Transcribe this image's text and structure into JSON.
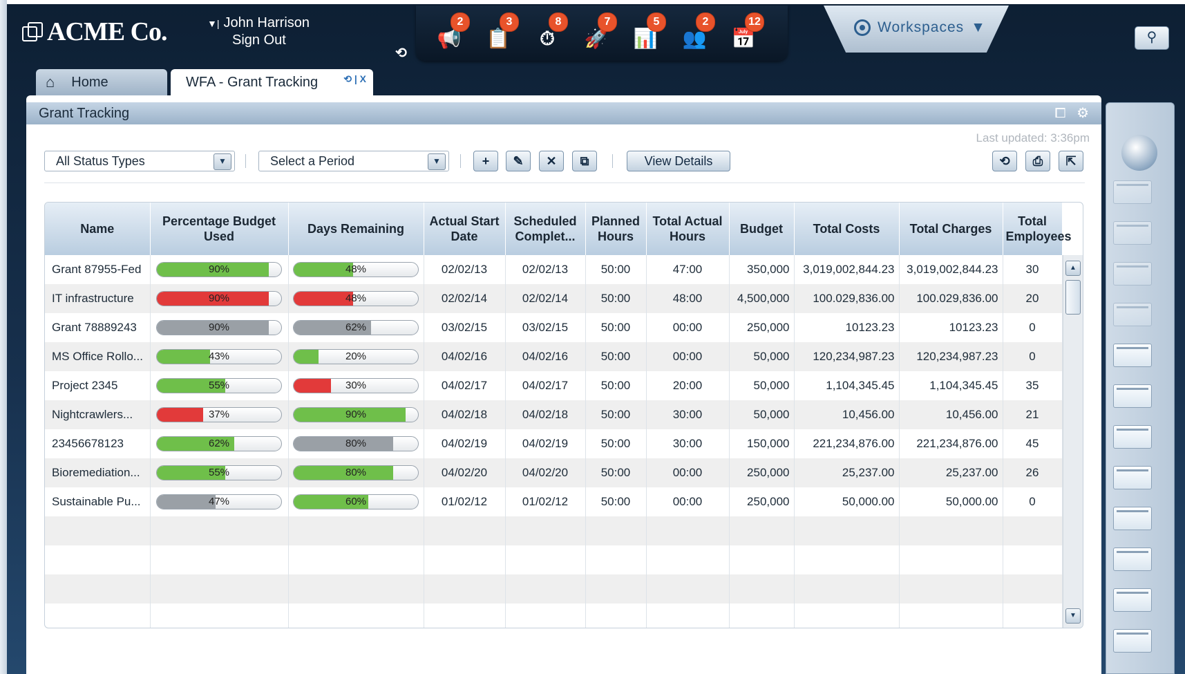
{
  "app": {
    "logo_text": "ACME Co."
  },
  "user": {
    "name": "John Harrison",
    "sign_out": "Sign Out"
  },
  "notifications": [
    {
      "icon": "megaphone-icon",
      "glyph": "📢",
      "count": "2"
    },
    {
      "icon": "clipboard-icon",
      "glyph": "📋",
      "count": "3"
    },
    {
      "icon": "stopwatch-icon",
      "glyph": "⏱",
      "count": "8"
    },
    {
      "icon": "rocket-icon",
      "glyph": "🚀",
      "count": "7"
    },
    {
      "icon": "chart-icon",
      "glyph": "📊",
      "count": "5"
    },
    {
      "icon": "people-icon",
      "glyph": "👥",
      "count": "2"
    },
    {
      "icon": "calendar-icon",
      "glyph": "📅",
      "count": "12"
    }
  ],
  "workspaces": {
    "label": "Workspaces"
  },
  "tabs": {
    "home": "Home",
    "active": "WFA - Grant Tracking",
    "active_close": "X"
  },
  "panel": {
    "title": "Grant Tracking",
    "last_updated": "Last updated: 3:36pm"
  },
  "toolbar": {
    "status_filter": "All Status Types",
    "period_filter": "Select a Period",
    "view_details": "View Details"
  },
  "table": {
    "columns": [
      "Name",
      "Percentage Budget Used",
      "Days Remaining",
      "Actual Start Date",
      "Scheduled Complet...",
      "Planned Hours",
      "Total Actual Hours",
      "Budget",
      "Total Costs",
      "Total Charges",
      "Total Employees"
    ],
    "rows": [
      {
        "name": "Grant 87955-Fed",
        "pct_budget": 90,
        "pct_budget_label": "90%",
        "pct_budget_color": "green",
        "days": 48,
        "days_label": "48%",
        "days_color": "green",
        "start": "02/02/13",
        "complete": "02/02/13",
        "planned": "50:00",
        "actual": "47:00",
        "budget": "350,000",
        "costs": "3,019,002,844.23",
        "charges": "3,019,002,844.23",
        "employees": "30"
      },
      {
        "name": "IT infrastructure",
        "pct_budget": 90,
        "pct_budget_label": "90%",
        "pct_budget_color": "red",
        "days": 48,
        "days_label": "48%",
        "days_color": "red",
        "start": "02/02/14",
        "complete": "02/02/14",
        "planned": "50:00",
        "actual": "48:00",
        "budget": "4,500,000",
        "costs": "100.029,836.00",
        "charges": "100.029,836.00",
        "employees": "20"
      },
      {
        "name": "Grant 78889243",
        "pct_budget": 90,
        "pct_budget_label": "90%",
        "pct_budget_color": "gray",
        "days": 62,
        "days_label": "62%",
        "days_color": "gray",
        "start": "03/02/15",
        "complete": "03/02/15",
        "planned": "50:00",
        "actual": "00:00",
        "budget": "250,000",
        "costs": "10123.23",
        "charges": "10123.23",
        "employees": "0"
      },
      {
        "name": "MS Office Rollo...",
        "pct_budget": 43,
        "pct_budget_label": "43%",
        "pct_budget_color": "green",
        "days": 20,
        "days_label": "20%",
        "days_color": "green",
        "start": "04/02/16",
        "complete": "04/02/16",
        "planned": "50:00",
        "actual": "00:00",
        "budget": "50,000",
        "costs": "120,234,987.23",
        "charges": "120,234,987.23",
        "employees": "0"
      },
      {
        "name": "Project 2345",
        "pct_budget": 55,
        "pct_budget_label": "55%",
        "pct_budget_color": "green",
        "days": 30,
        "days_label": "30%",
        "days_color": "red",
        "start": "04/02/17",
        "complete": "04/02/17",
        "planned": "50:00",
        "actual": "20:00",
        "budget": "50,000",
        "costs": "1,104,345.45",
        "charges": "1,104,345.45",
        "employees": "35"
      },
      {
        "name": "Nightcrawlers...",
        "pct_budget": 37,
        "pct_budget_label": "37%",
        "pct_budget_color": "red",
        "days": 90,
        "days_label": "90%",
        "days_color": "green",
        "start": "04/02/18",
        "complete": "04/02/18",
        "planned": "50:00",
        "actual": "30:00",
        "budget": "50,000",
        "costs": "10,456.00",
        "charges": "10,456.00",
        "employees": "21"
      },
      {
        "name": "23456678123",
        "pct_budget": 62,
        "pct_budget_label": "62%",
        "pct_budget_color": "green",
        "days": 80,
        "days_label": "80%",
        "days_color": "gray",
        "start": "04/02/19",
        "complete": "04/02/19",
        "planned": "50:00",
        "actual": "30:00",
        "budget": "150,000",
        "costs": "221,234,876.00",
        "charges": "221,234,876.00",
        "employees": "45"
      },
      {
        "name": "Bioremediation...",
        "pct_budget": 55,
        "pct_budget_label": "55%",
        "pct_budget_color": "green",
        "days": 80,
        "days_label": "80%",
        "days_color": "green",
        "start": "04/02/20",
        "complete": "04/02/20",
        "planned": "50:00",
        "actual": "00:00",
        "budget": "250,000",
        "costs": "25,237.00",
        "charges": "25,237.00",
        "employees": "26"
      },
      {
        "name": "Sustainable Pu...",
        "pct_budget": 47,
        "pct_budget_label": "47%",
        "pct_budget_color": "gray",
        "days": 60,
        "days_label": "60%",
        "days_color": "green",
        "start": "01/02/12",
        "complete": "01/02/12",
        "planned": "50:00",
        "actual": "00:00",
        "budget": "250,000",
        "costs": "50,000.00",
        "charges": "50,000.00",
        "employees": "0"
      }
    ]
  },
  "colors": {
    "green": "#6fbf4a",
    "red": "#e23a3a",
    "gray": "#9aa0a6",
    "accent": "#2d5f8f"
  }
}
